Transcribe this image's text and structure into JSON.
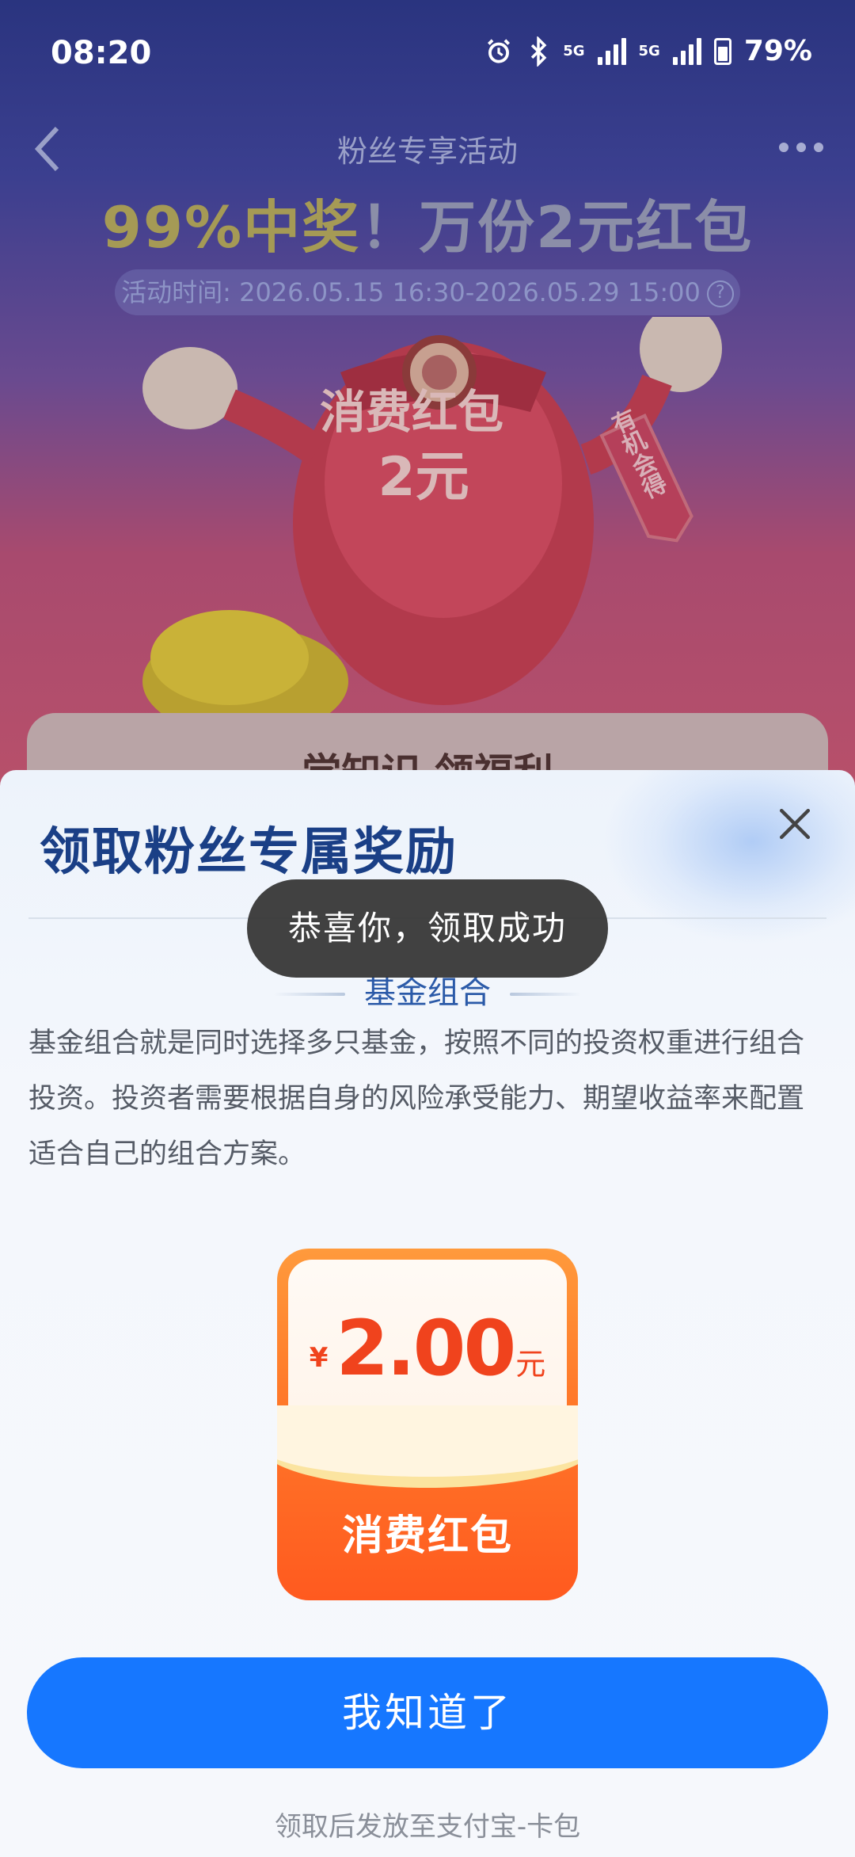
{
  "status_bar": {
    "time": "08:20",
    "network1": "5G",
    "network2": "5G",
    "battery": "79%"
  },
  "nav": {
    "title": "粉丝专享活动"
  },
  "promo": {
    "headline_highlight": "99%中奖",
    "headline_rest": "！万份2元红包",
    "time_label": "活动时间: 2026.05.15 16:30-2026.05.29 15:00",
    "help_glyph": "?",
    "mascot_text1": "消费红包",
    "mascot_text2": "2元",
    "mascot_tag": "有机会得",
    "card_title": "学知识 领福利"
  },
  "sheet": {
    "title": "领取粉丝专属奖励",
    "section_title": "基金组合",
    "description": "基金组合就是同时选择多只基金，按照不同的投资权重进行组合投资。投资者需要根据自身的风险承受能力、期望收益率来配置适合自己的组合方案。",
    "reward": {
      "currency": "¥",
      "amount": "2.00",
      "unit": "元",
      "label": "消费红包"
    },
    "confirm_label": "我知道了",
    "footnote": "领取后发放至支付宝-卡包"
  },
  "toast": {
    "message": "恭喜你，领取成功"
  },
  "colors": {
    "accent_blue": "#1677ff",
    "title_blue": "#1a3f86",
    "red_amount": "#f0431d",
    "packet_orange": "#ff7a2a"
  }
}
